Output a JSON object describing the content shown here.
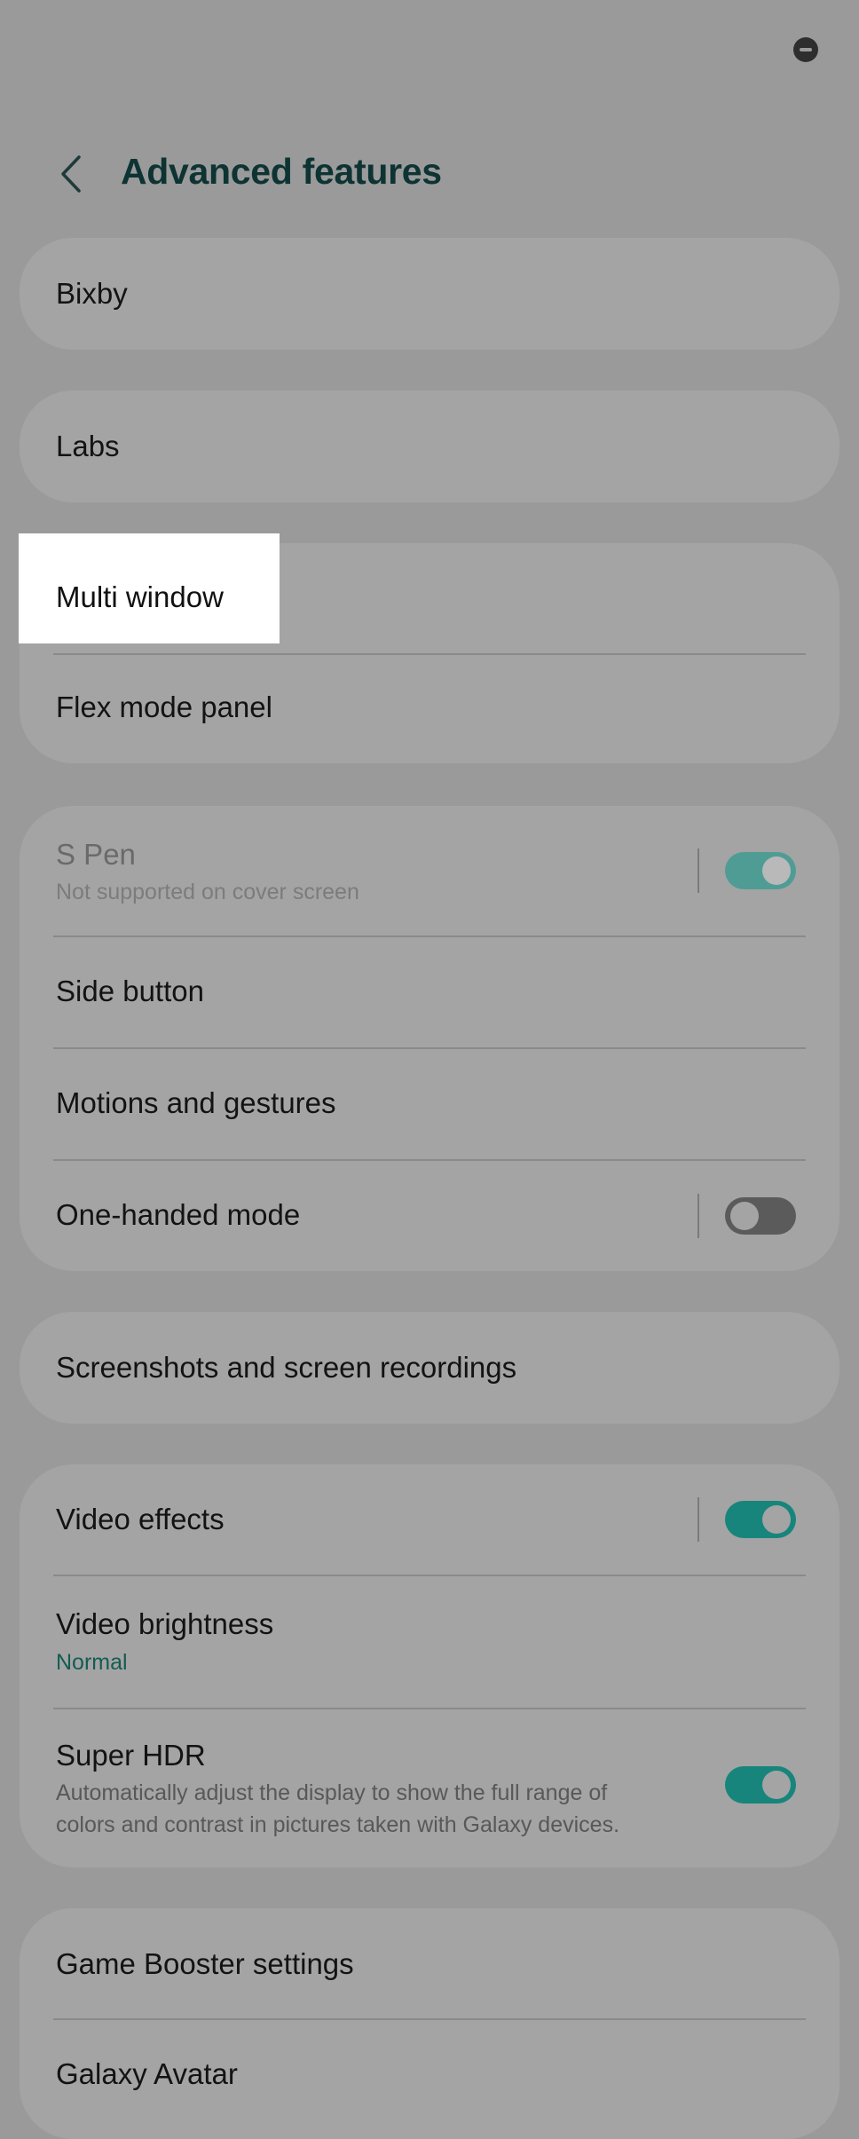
{
  "status_bar": {
    "icon": "do-not-disturb-icon"
  },
  "header": {
    "back_icon": "chevron-left-icon",
    "title": "Advanced features"
  },
  "rows": {
    "bixby": {
      "title": "Bixby"
    },
    "labs": {
      "title": "Labs"
    },
    "multi_window": {
      "title": "Multi window"
    },
    "flex_mode_panel": {
      "title": "Flex mode panel"
    },
    "s_pen": {
      "title": "S Pen",
      "subtitle": "Not supported on cover screen",
      "enabled": false,
      "toggle": true
    },
    "side_button": {
      "title": "Side button"
    },
    "motions_gestures": {
      "title": "Motions and gestures"
    },
    "one_handed_mode": {
      "title": "One-handed mode",
      "toggle": false
    },
    "screenshots": {
      "title": "Screenshots and screen recordings"
    },
    "video_effects": {
      "title": "Video effects",
      "toggle": true
    },
    "video_brightness": {
      "title": "Video brightness",
      "value": "Normal"
    },
    "super_hdr": {
      "title": "Super HDR",
      "subtitle_line1": "Automatically adjust the display to show the full range of",
      "subtitle_line2": "colors and contrast in pictures taken with Galaxy devices.",
      "toggle": true
    },
    "game_booster": {
      "title": "Game Booster settings"
    },
    "galaxy_avatar": {
      "title": "Galaxy Avatar"
    }
  },
  "colors": {
    "accent": "#17857c",
    "title": "#0e3333"
  }
}
